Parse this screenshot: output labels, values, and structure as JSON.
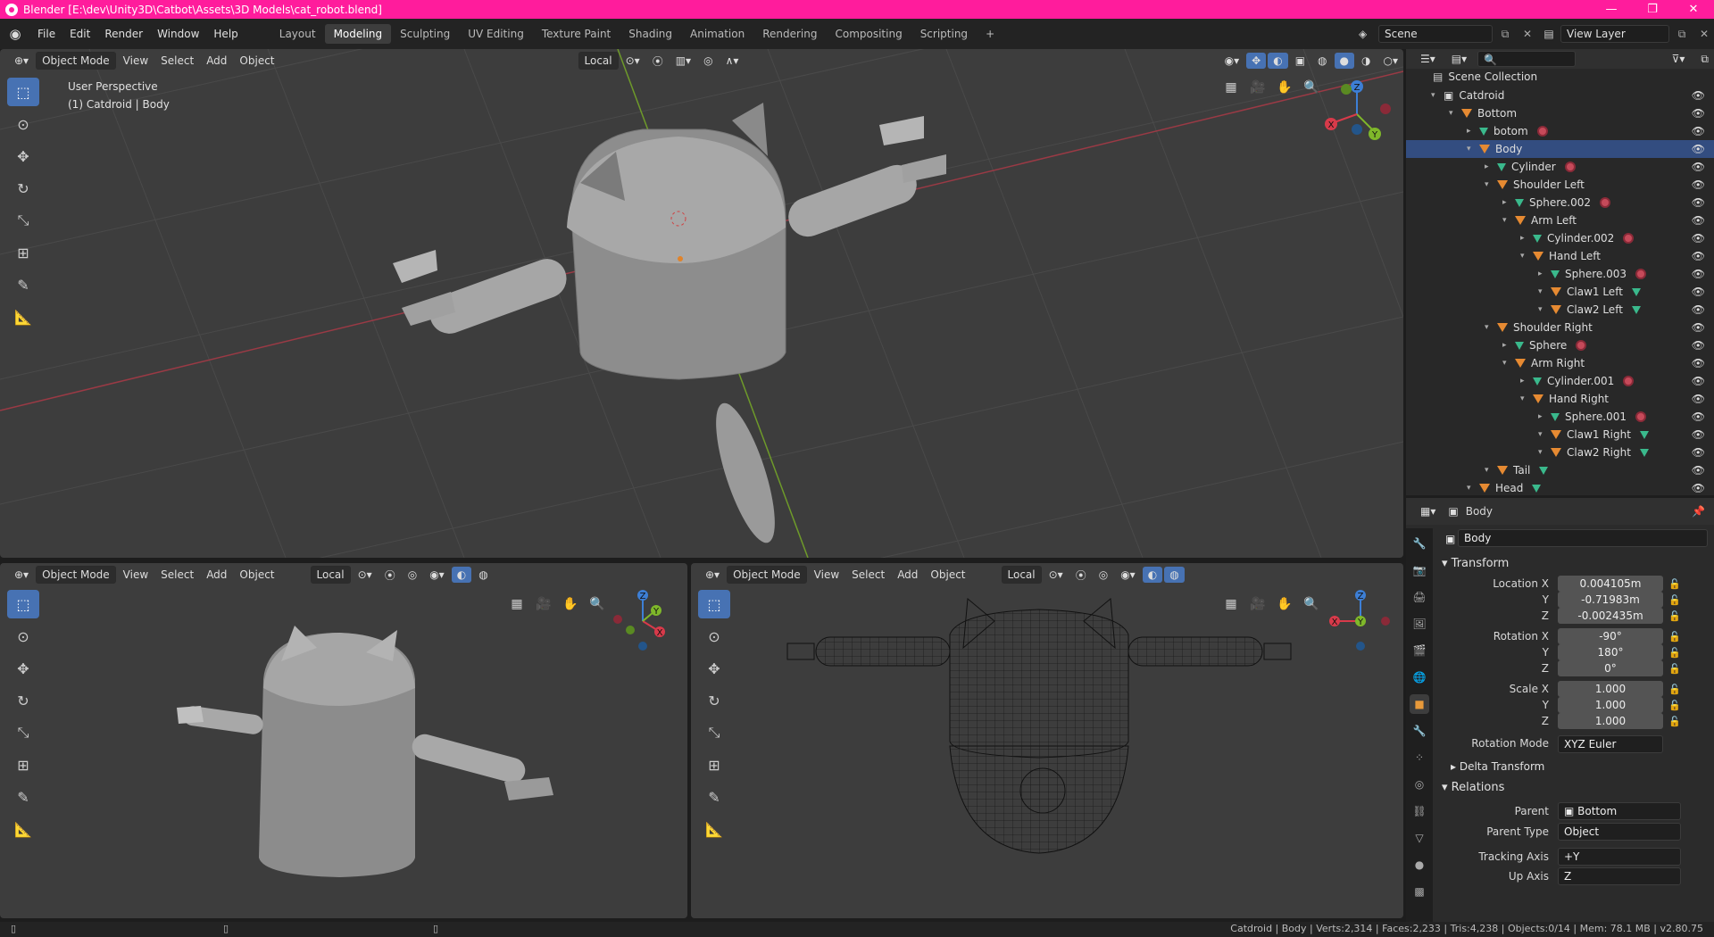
{
  "window": {
    "title": "Blender [E:\\dev\\Unity3D\\Catbot\\Assets\\3D Models\\cat_robot.blend]"
  },
  "menu": [
    "File",
    "Edit",
    "Render",
    "Window",
    "Help"
  ],
  "workspaces": [
    "Layout",
    "Modeling",
    "Sculpting",
    "UV Editing",
    "Texture Paint",
    "Shading",
    "Animation",
    "Rendering",
    "Compositing",
    "Scripting"
  ],
  "active_workspace": "Modeling",
  "scene": "Scene",
  "view_layer": "View Layer",
  "viewport_header": {
    "mode": "Object Mode",
    "menus": [
      "View",
      "Select",
      "Add",
      "Object"
    ],
    "orientation": "Local"
  },
  "main_viewport": {
    "perspective": "User Perspective",
    "object": "(1) Catdroid | Body"
  },
  "gizmo": {
    "x": "X",
    "y": "Y",
    "z": "Z"
  },
  "outliner": {
    "root": "Scene Collection",
    "items": [
      {
        "label": "Catdroid"
      },
      {
        "label": "Bottom"
      },
      {
        "label": "botom"
      },
      {
        "label": "Body"
      },
      {
        "label": "Cylinder"
      },
      {
        "label": "Shoulder Left"
      },
      {
        "label": "Sphere.002"
      },
      {
        "label": "Arm Left"
      },
      {
        "label": "Cylinder.002"
      },
      {
        "label": "Hand Left"
      },
      {
        "label": "Sphere.003"
      },
      {
        "label": "Claw1 Left"
      },
      {
        "label": "Claw2 Left"
      },
      {
        "label": "Shoulder Right"
      },
      {
        "label": "Sphere"
      },
      {
        "label": "Arm Right"
      },
      {
        "label": "Cylinder.001"
      },
      {
        "label": "Hand Right"
      },
      {
        "label": "Sphere.001"
      },
      {
        "label": "Claw1 Right"
      },
      {
        "label": "Claw2 Right"
      },
      {
        "label": "Tail"
      },
      {
        "label": "Head"
      }
    ]
  },
  "properties": {
    "object_name": "Body",
    "data_name": "Body",
    "transform_title": "Transform",
    "location_label": "Location X",
    "location": [
      "0.004105m",
      "-0.71983m",
      "-0.002435m"
    ],
    "rotation_label": "Rotation X",
    "rotation": [
      "-90°",
      "180°",
      "0°"
    ],
    "scale_label": "Scale X",
    "scale": [
      "1.000",
      "1.000",
      "1.000"
    ],
    "axis_y": "Y",
    "axis_z": "Z",
    "rotation_mode_label": "Rotation Mode",
    "rotation_mode": "XYZ Euler",
    "delta_title": "Delta Transform",
    "relations_title": "Relations",
    "parent_label": "Parent",
    "parent": "Bottom",
    "parent_type_label": "Parent Type",
    "parent_type": "Object",
    "tracking_axis_label": "Tracking Axis",
    "tracking_axis": "+Y",
    "up_axis_label": "Up Axis",
    "up_axis": "Z"
  },
  "status": "Catdroid | Body | Verts:2,314 | Faces:2,233 | Tris:4,238 | Objects:0/14 | Mem: 78.1 MB | v2.80.75"
}
